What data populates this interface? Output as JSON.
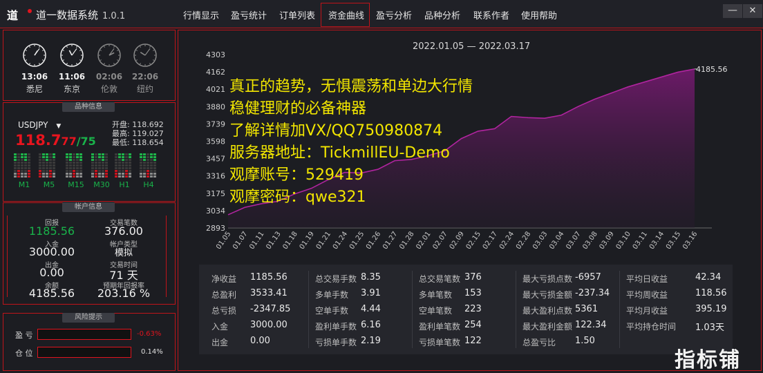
{
  "app": {
    "title": "道一数据系统",
    "version": "1.0.1"
  },
  "tabs": [
    "行情显示",
    "盈亏统计",
    "订单列表",
    "资金曲线",
    "盈亏分析",
    "品种分析",
    "联系作者",
    "使用帮助"
  ],
  "window": {
    "minimize": "—",
    "close": "✕"
  },
  "clocks": [
    {
      "time": "13:06",
      "city": "悉尼",
      "active": true
    },
    {
      "time": "11:06",
      "city": "东京",
      "active": true
    },
    {
      "time": "02:06",
      "city": "伦敦",
      "active": false
    },
    {
      "time": "22:06",
      "city": "纽约",
      "active": false
    }
  ],
  "symbol_info": {
    "section": "品种信息",
    "symbol": "USDJPY",
    "price_main": "118.7",
    "price_sub": "77",
    "spread": "75",
    "open_label": "开盘:",
    "open": "118.692",
    "high_label": "最高:",
    "high": "119.027",
    "low_label": "最低:",
    "low": "118.654",
    "timeframes": [
      "M1",
      "M5",
      "M15",
      "M30",
      "H1",
      "H4"
    ]
  },
  "account_info": {
    "section": "帐户信息",
    "profit_label": "回报",
    "profit": "1185.56",
    "trades_label": "交易笔数",
    "trades": "376.00",
    "deposit_label": "入金",
    "deposit": "3000.00",
    "acct_type_label": "帐户类型",
    "acct_type": "模拟",
    "withdraw_label": "出金",
    "withdraw": "0.00",
    "time_label": "交易时间",
    "time": "71 天",
    "balance_label": "余额",
    "balance": "4185.56",
    "annual_label": "预期年回报率",
    "annual": "203.16 %"
  },
  "risk": {
    "section": "风险提示",
    "pl_label": "盈 亏",
    "pl_value": "-0.63%",
    "pos_label": "仓 位",
    "pos_value": "0.14%"
  },
  "overlay_lines": [
    "真正的趋势，无惧震荡和单边大行情",
    "稳健理财的必备神器",
    "了解详情加VX/QQ750980874",
    "服务器地址：TickmillEU-Demo",
    "观摩账号：529419",
    "观摩密码：qwe321"
  ],
  "watermark": "指标铺",
  "chart_data": {
    "type": "area",
    "title": "2022.01.05 — 2022.03.17",
    "x": [
      "01.05",
      "01.07",
      "01.11",
      "01.13",
      "01.18",
      "01.19",
      "01.21",
      "01.24",
      "01.25",
      "01.26",
      "01.27",
      "01.28",
      "02.01",
      "02.07",
      "02.09",
      "02.15",
      "02.17",
      "02.24",
      "02.28",
      "03.03",
      "03.04",
      "03.07",
      "03.08",
      "03.09",
      "03.10",
      "03.11",
      "03.14",
      "03.15",
      "03.16"
    ],
    "y": [
      3000,
      3060,
      3090,
      3110,
      3170,
      3215,
      3285,
      3345,
      3340,
      3370,
      3440,
      3450,
      3480,
      3520,
      3620,
      3680,
      3700,
      3800,
      3790,
      3785,
      3810,
      3880,
      3940,
      3990,
      4040,
      4080,
      4120,
      4160,
      4185.56
    ],
    "yticks": [
      2893,
      3034,
      3175,
      3316,
      3457,
      3598,
      3739,
      3880,
      4021,
      4162,
      4303
    ],
    "ylim": [
      2893,
      4303
    ],
    "end_label": "4185.56",
    "line_color": "#b0249f",
    "grid": false
  },
  "stats": [
    [
      {
        "l": "净收益",
        "v": "1185.56"
      },
      {
        "l": "总盈利",
        "v": "3533.41"
      },
      {
        "l": "总亏损",
        "v": "-2347.85"
      },
      {
        "l": "入金",
        "v": "3000.00"
      },
      {
        "l": "出金",
        "v": "0.00"
      }
    ],
    [
      {
        "l": "总交易手数",
        "v": "8.35"
      },
      {
        "l": "多单手数",
        "v": "3.91"
      },
      {
        "l": "空单手数",
        "v": "4.44"
      },
      {
        "l": "盈利单手数",
        "v": "6.16"
      },
      {
        "l": "亏损单手数",
        "v": "2.19"
      }
    ],
    [
      {
        "l": "总交易笔数",
        "v": "376"
      },
      {
        "l": "多单笔数",
        "v": "153"
      },
      {
        "l": "空单笔数",
        "v": "223"
      },
      {
        "l": "盈利单笔数",
        "v": "254"
      },
      {
        "l": "亏损单笔数",
        "v": "122"
      }
    ],
    [
      {
        "l": "最大亏损点数",
        "v": "-6957"
      },
      {
        "l": "最大亏损金额",
        "v": "-237.34"
      },
      {
        "l": "最大盈利点数",
        "v": "5361"
      },
      {
        "l": "最大盈利金额",
        "v": "122.34"
      },
      {
        "l": "总盈亏比",
        "v": "1.50"
      }
    ],
    [
      {
        "l": "平均日收益",
        "v": "42.34"
      },
      {
        "l": "平均周收益",
        "v": "118.56"
      },
      {
        "l": "平均月收益",
        "v": "395.19"
      },
      {
        "l": "平均持仓时间",
        "v": "1.03天"
      }
    ]
  ]
}
